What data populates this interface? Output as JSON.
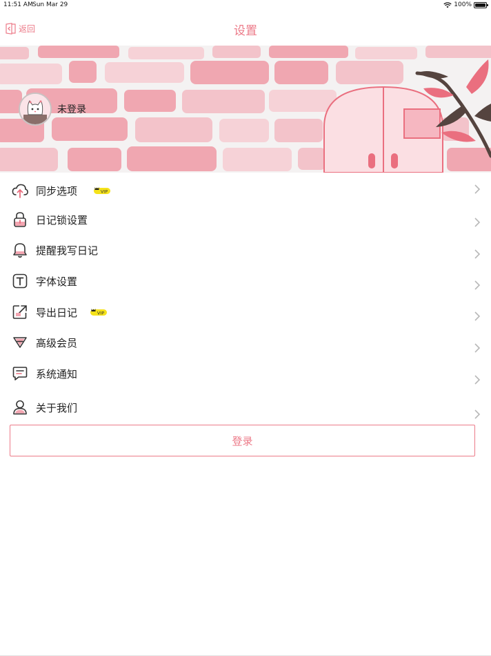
{
  "status_bar": {
    "time": "11:51 AM",
    "date": "Sun Mar 29",
    "battery": "100%"
  },
  "nav": {
    "back_label": "返回",
    "title": "设置"
  },
  "profile": {
    "login_status": "未登录"
  },
  "settings": {
    "items": [
      {
        "label": "同步选项",
        "icon": "cloud-upload-icon",
        "vip": true
      },
      {
        "label": "日记锁设置",
        "icon": "lock-icon",
        "vip": false
      },
      {
        "label": "提醒我写日记",
        "icon": "bell-icon",
        "vip": false
      },
      {
        "label": "字体设置",
        "icon": "font-icon",
        "vip": false
      },
      {
        "label": "导出日记",
        "icon": "export-icon",
        "vip": true
      },
      {
        "label": "高级会员",
        "icon": "diamond-icon",
        "vip": false
      },
      {
        "label": "系统通知",
        "icon": "message-icon",
        "vip": false
      },
      {
        "label": "关于我们",
        "icon": "user-icon",
        "vip": false
      }
    ],
    "vip_text": "VIP"
  },
  "login_button": {
    "label": "登录"
  },
  "colors": {
    "accent": "#ec7a88",
    "badge_yellow": "#f5e21a",
    "brick_pink": "#f0a7b1"
  }
}
